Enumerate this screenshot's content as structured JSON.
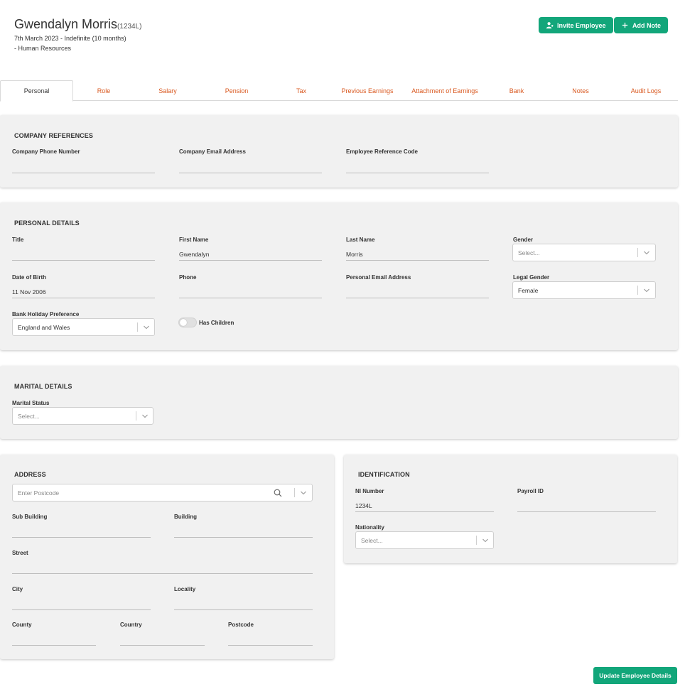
{
  "employee": {
    "name": "Gwendalyn Morris",
    "code": "(1234L)",
    "employment": "7th March 2023 - Indefinite (10 months)",
    "department": "- Human Resources"
  },
  "actions": {
    "invite": "Invite Employee",
    "add_note": "Add Note"
  },
  "tabs": [
    "Personal",
    "Role",
    "Salary",
    "Pension",
    "Tax",
    "Previous Earnings",
    "Attachment of Earnings",
    "Bank",
    "Notes",
    "Audit Logs"
  ],
  "company_references": {
    "title": "COMPANY REFERENCES",
    "phone_label": "Company Phone Number",
    "phone_value": "",
    "email_label": "Company Email Address",
    "email_value": "",
    "refcode_label": "Employee Reference Code",
    "refcode_value": ""
  },
  "personal_details": {
    "title": "PERSONAL DETAILS",
    "title_label": "Title",
    "title_value": "",
    "first_name_label": "First Name",
    "first_name_value": "Gwendalyn",
    "last_name_label": "Last Name",
    "last_name_value": "Morris",
    "gender_label": "Gender",
    "gender_placeholder": "Select...",
    "dob_label": "Date of Birth",
    "dob_value": "11 Nov 2006",
    "phone_label": "Phone",
    "phone_value": "",
    "email_label": "Personal Email Address",
    "email_value": "",
    "legal_gender_label": "Legal Gender",
    "legal_gender_value": "Female",
    "bank_holiday_label": "Bank Holiday Preference",
    "bank_holiday_value": "England and Wales",
    "has_children_label": "Has Children"
  },
  "marital_details": {
    "title": "MARITAL DETAILS",
    "status_label": "Marital Status",
    "status_placeholder": "Select..."
  },
  "address": {
    "title": "ADDRESS",
    "postcode_search_placeholder": "Enter Postcode",
    "sub_building_label": "Sub Building",
    "building_label": "Building",
    "street_label": "Street",
    "city_label": "City",
    "locality_label": "Locality",
    "county_label": "County",
    "country_label": "Country",
    "postcode_label": "Postcode"
  },
  "identification": {
    "title": "IDENTIFICATION",
    "ni_label": "NI Number",
    "ni_value": "1234L",
    "payroll_label": "Payroll ID",
    "payroll_value": "",
    "nationality_label": "Nationality",
    "nationality_placeholder": "Select..."
  },
  "footer": {
    "update_label": "Update Employee Details"
  },
  "colors": {
    "accent": "#12a67a",
    "tab_link": "#d9581f",
    "panel_bg": "#f1f1f1"
  },
  "icons": {
    "invite": "user-plus-icon",
    "add_note": "plus-icon",
    "search": "search-icon",
    "chevron": "chevron-down-icon"
  }
}
